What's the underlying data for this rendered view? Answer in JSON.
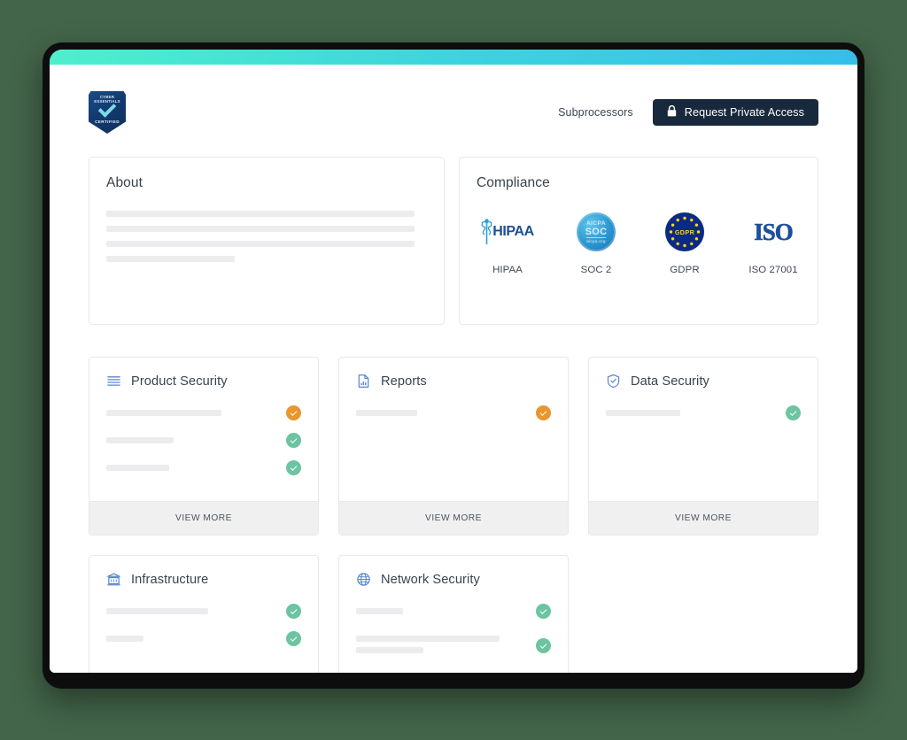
{
  "theme": {
    "page_background": "#43654A",
    "accent_gradient_start": "#4DEFCE",
    "accent_gradient_end": "#35BEE8",
    "button_background": "#18283D",
    "status_green": "#6CC4A1",
    "status_orange": "#E8962E",
    "card_border": "#E6E8EB",
    "skeleton": "#ECECEE",
    "view_more_background": "#F0F0F1"
  },
  "header": {
    "logo": {
      "icon": "cyber-essentials-badge-icon",
      "top_text": "Cyber Essentials",
      "bottom_text": "Certified"
    },
    "nav_link": "Subprocessors",
    "cta": {
      "icon": "lock-icon",
      "label": "Request Private Access"
    }
  },
  "about": {
    "title": "About",
    "skeleton_widths": [
      "96%",
      "96%",
      "96%",
      "40%"
    ]
  },
  "compliance": {
    "title": "Compliance",
    "badges": [
      {
        "label": "HIPAA",
        "icon": "hipaa-caduceus-icon",
        "wordmark": "HIPAA"
      },
      {
        "label": "SOC 2",
        "icon": "aicpa-soc-seal-icon",
        "top": "AICPA",
        "main": "SOC",
        "sub": "aicpa.org"
      },
      {
        "label": "GDPR",
        "icon": "gdpr-eu-stars-icon",
        "wordmark": "GDPR"
      },
      {
        "label": "ISO 27001",
        "icon": "iso-wordmark-icon",
        "wordmark": "ISO"
      }
    ]
  },
  "view_more_label": "VIEW MORE",
  "feature_cards": [
    {
      "title": "Product Security",
      "icon": "list-lines-icon",
      "rows": [
        {
          "lines": [
            "68%"
          ],
          "status": "orange"
        },
        {
          "lines": [
            "40%"
          ],
          "status": "green"
        },
        {
          "lines": [
            "37%"
          ],
          "status": "green"
        }
      ]
    },
    {
      "title": "Reports",
      "icon": "report-document-icon",
      "rows": [
        {
          "lines": [
            "36%"
          ],
          "status": "orange"
        }
      ]
    },
    {
      "title": "Data Security",
      "icon": "shield-check-icon",
      "rows": [
        {
          "lines": [
            "44%"
          ],
          "status": "green"
        }
      ]
    },
    {
      "title": "Infrastructure",
      "icon": "bank-building-icon",
      "rows": [
        {
          "lines": [
            "60%"
          ],
          "status": "green"
        },
        {
          "lines": [
            "22%"
          ],
          "status": "green"
        }
      ]
    },
    {
      "title": "Network Security",
      "icon": "globe-icon",
      "rows": [
        {
          "lines": [
            "28%"
          ],
          "status": "green"
        },
        {
          "lines": [
            "85%",
            "40%"
          ],
          "status": "green"
        }
      ]
    }
  ]
}
